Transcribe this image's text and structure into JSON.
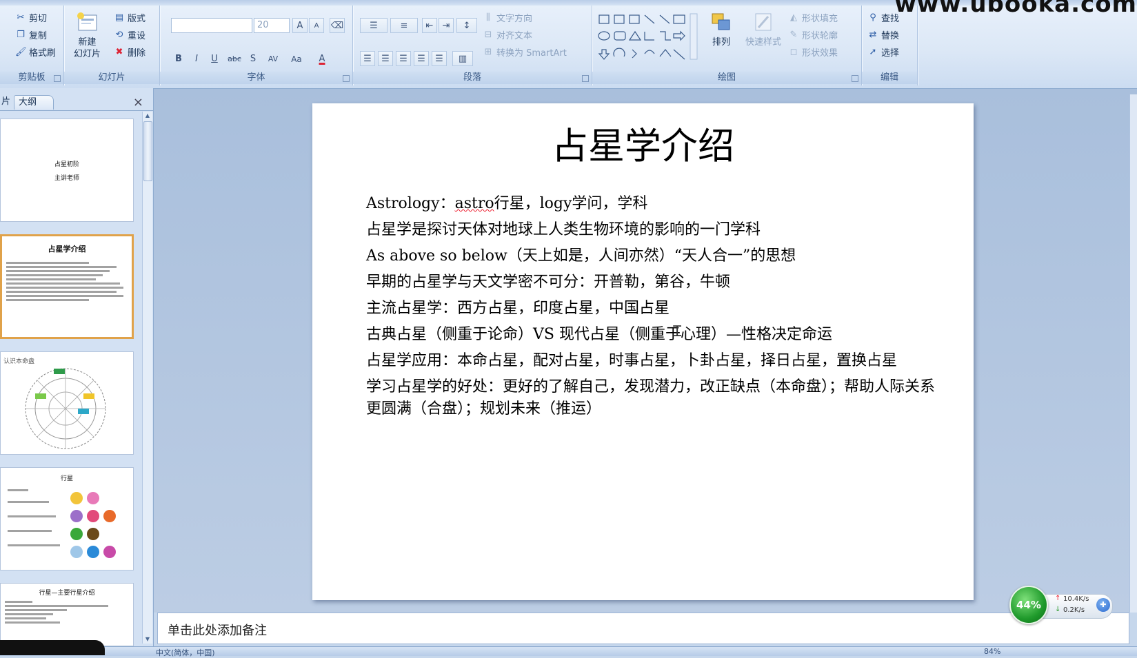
{
  "ribbon": {
    "watermark": "www.ubooka.com",
    "clipboard": {
      "label": "剪贴板",
      "cut": "剪切",
      "copy": "复制",
      "format_painter": "格式刷"
    },
    "slides": {
      "label": "幻灯片",
      "new_slide_line1": "新建",
      "new_slide_line2": "幻灯片",
      "layout": "版式",
      "reset": "重设",
      "delete": "删除"
    },
    "font": {
      "label": "字体",
      "font_size": "20",
      "bold": "B",
      "italic": "I",
      "underline": "U",
      "strike": "abc",
      "shadow": "S",
      "spacing": "AV",
      "case": "Aa",
      "color": "A",
      "grow": "A",
      "shrink": "A"
    },
    "paragraph": {
      "label": "段落",
      "text_direction": "文字方向",
      "align_text": "对齐文本",
      "convert_smartart": "转换为 SmartArt"
    },
    "drawing": {
      "label": "绘图",
      "arrange": "排列",
      "quick_styles": "快速样式",
      "shape_fill": "形状填充",
      "shape_outline": "形状轮廓",
      "shape_effects": "形状效果"
    },
    "editing": {
      "label": "编辑",
      "find": "查找",
      "replace": "替换",
      "select": "选择"
    }
  },
  "pane": {
    "tab_slides": "片",
    "tab_outline": "大纲",
    "close": "×",
    "thumbs": [
      {
        "title": "占星初阶",
        "subtitle": "主讲老师"
      },
      {
        "title": "占星学介绍"
      },
      {
        "title": "认识本命盘"
      },
      {
        "title": "行星"
      },
      {
        "title": "行星—主要行星介绍"
      }
    ]
  },
  "slide": {
    "title": "占星学介绍",
    "line1_pre": "Astrology：",
    "line1_wavy": "astro",
    "line1_post": "行星，logy学问，学科",
    "lines": [
      "占星学是探讨天体对地球上人类生物环境的影响的一门学科",
      "As above so below（天上如是，人间亦然）“天人合一”的思想",
      "早期的占星学与天文学密不可分：开普勒，第谷，牛顿",
      "主流占星学：西方占星，印度占星，中国占星",
      "古典占星（侧重于论命）VS 现代占星（侧重于心理）—性格决定命运",
      "占星学应用：本命占星，配对占星，时事占星，卜卦占星，择日占星，置换占星",
      "学习占星学的好处：更好的了解自己，发现潜力，改正缺点（本命盘）；帮助人际关系更圆满（合盘）；规划未来（推运）"
    ]
  },
  "notes": {
    "placeholder": "单击此处添加备注"
  },
  "status": {
    "language": "中文(简体，中国)",
    "zoom": "84%"
  },
  "netmon": {
    "percent": "44%",
    "upload": "10.4K/s",
    "download": "0.2K/s"
  }
}
